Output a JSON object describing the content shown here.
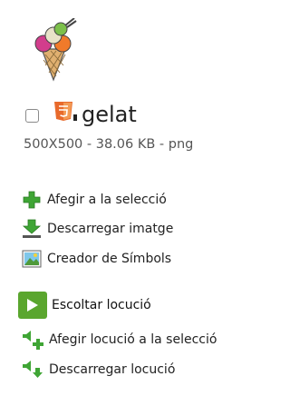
{
  "item": {
    "title": "gelat",
    "meta": "500X500 - 38.06 KB - png",
    "image_icon": "ice-cream-cone-icon",
    "format_icon": "html5-icon"
  },
  "actions": {
    "add_selection": {
      "label": "Afegir a la selecció",
      "icon": "plus-icon"
    },
    "download_image": {
      "label": "Descarregar imatge",
      "icon": "download-icon"
    },
    "symbol_creator": {
      "label": "Creador de Símbols",
      "icon": "image-icon"
    },
    "listen": {
      "label": "Escoltar locució",
      "icon": "play-icon"
    },
    "add_audio_selection": {
      "label": "Afegir locució a la selecció",
      "icon": "speaker-plus-icon"
    },
    "download_audio": {
      "label": "Descarregar locució",
      "icon": "speaker-download-icon"
    }
  },
  "colors": {
    "green": "#3fa535",
    "play_green": "#5aa62e",
    "html5_orange": "#e86a2c"
  }
}
